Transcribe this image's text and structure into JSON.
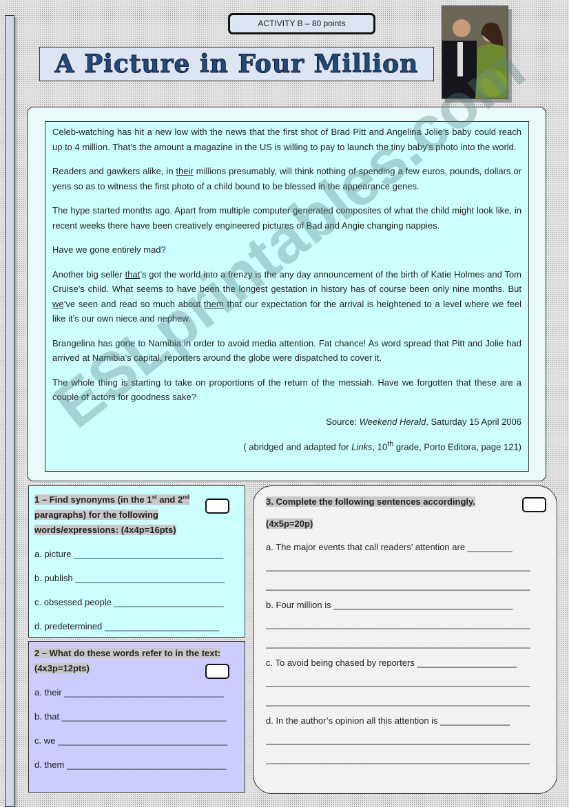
{
  "activity": "ACTIVITY B – 80 points",
  "title": "A Picture in Four Million",
  "photo_alt": "Brad Pitt and Angelina Jolie photo",
  "watermark": "ESLprintables.com",
  "passage": {
    "p1": "Celeb-watching has hit a new low with the news that the first shot of Brad Pitt and Angelina Jolie’s baby could reach up to 4 million. That’s the amount a magazine in the US is willing to pay to launch the tiny baby’s photo into the world.",
    "p2a": "Readers and gawkers alike, in ",
    "p2u": "their",
    "p2b": " millions presumably, will think nothing of spending a few euros, pounds, dollars or yens so as to witness the first photo of a child bound to be blessed in the appearance genes.",
    "p3": "The hype started months ago. Apart from multiple computer generated composites of what the child might look like, in recent weeks there have been creatively engineered pictures of Bad and Angie changing nappies.",
    "p4": "Have we gone entirely mad?",
    "p5a": "Another big seller ",
    "p5u1": "that",
    "p5b": "’s got the world into a frenzy is the any day announcement of the birth of Katie Holmes and Tom Cruise’s child. What seems to have been the longest gestation in history has of course been only nine months. But ",
    "p5u2": "we",
    "p5c": "’ve seen and read so much about ",
    "p5u3": "them",
    "p5d": " that our expectation for the arrival is heightened to a level where we feel like it’s our own niece and nephew.",
    "p6": "Brangelina has gone to Namibia in order to avoid media attention. Fat chance! As word spread that Pitt and Jolie had arrived at Namibia’s capital, reporters around the globe were dispatched to cover it.",
    "p7": "The whole thing is starting to take on proportions of the return of the messiah. Have we forgotten that these are a couple of actors for goodness sake?",
    "source_label": "Source: ",
    "source_title": "Weekend Herald",
    "source_date": ", Saturday 15 April 2006",
    "adapt_a": "( abridged and adapted for ",
    "adapt_title": "Links",
    "adapt_b": ", 10",
    "adapt_sup": "th",
    "adapt_c": " grade, Porto Editora, page 121)"
  },
  "ex1": {
    "h_a": "1 – Find synonyms (in the 1",
    "h_sup1": "st",
    "h_b": " and 2",
    "h_sup2": "nd",
    "h_c": "paragraphs) for the following",
    "h_d": "words/expressions: (4x4p=16pts)",
    "items": [
      "a. picture ______________________________",
      "b. publish ______________________________",
      "c. obsessed people ______________________",
      "d. predetermined _______________________"
    ]
  },
  "ex2": {
    "h_a": "2 – What do these words refer to in the text:",
    "h_b": "(4x3p=12pts)",
    "items": [
      "a. their ________________________________",
      "b. that _________________________________",
      "c. we __________________________________",
      "d. them ________________________________"
    ]
  },
  "ex3": {
    "h_a": "3. Complete the following sentences accordingly.",
    "h_b": "(4x5p=20p)",
    "items": [
      "a. The major events that call readers’ attention are _________",
      "b. Four million is ____________________________________",
      "c. To avoid being chased by reporters ____________________",
      "d. In the author’s opinion all this attention is ______________"
    ],
    "blank": "_____________________________________________________"
  }
}
